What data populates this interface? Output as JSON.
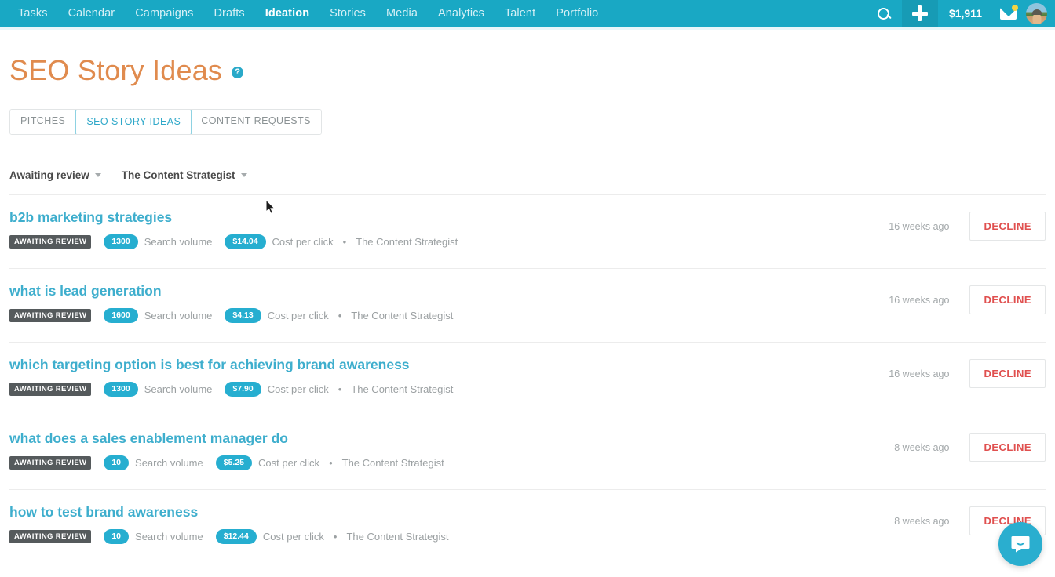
{
  "nav": {
    "links": [
      {
        "label": "Tasks",
        "active": false
      },
      {
        "label": "Calendar",
        "active": false
      },
      {
        "label": "Campaigns",
        "active": false
      },
      {
        "label": "Drafts",
        "active": false
      },
      {
        "label": "Ideation",
        "active": true
      },
      {
        "label": "Stories",
        "active": false
      },
      {
        "label": "Media",
        "active": false
      },
      {
        "label": "Analytics",
        "active": false
      },
      {
        "label": "Talent",
        "active": false
      },
      {
        "label": "Portfolio",
        "active": false
      }
    ],
    "balance": "$1,911",
    "accent_color": "#19a8c4"
  },
  "header": {
    "title": "SEO Story Ideas",
    "help_label": "?",
    "title_color": "#e08b4e"
  },
  "tabs": [
    {
      "label": "PITCHES",
      "active": false
    },
    {
      "label": "SEO STORY IDEAS",
      "active": true
    },
    {
      "label": "CONTENT REQUESTS",
      "active": false
    }
  ],
  "filters": [
    {
      "label": "Awaiting review"
    },
    {
      "label": "The Content Strategist"
    }
  ],
  "labels": {
    "search_volume": "Search volume",
    "cost_per_click": "Cost per click",
    "separator": "•",
    "decline": "DECLINE"
  },
  "rows": [
    {
      "title": "b2b marketing strategies",
      "status": "AWAITING REVIEW",
      "search_volume": "1300",
      "cost_per_click": "$14.04",
      "publication": "The Content Strategist",
      "time": "16 weeks ago",
      "action": "DECLINE"
    },
    {
      "title": "what is lead generation",
      "status": "AWAITING REVIEW",
      "search_volume": "1600",
      "cost_per_click": "$4.13",
      "publication": "The Content Strategist",
      "time": "16 weeks ago",
      "action": "DECLINE"
    },
    {
      "title": "which targeting option is best for achieving brand awareness",
      "status": "AWAITING REVIEW",
      "search_volume": "1300",
      "cost_per_click": "$7.90",
      "publication": "The Content Strategist",
      "time": "16 weeks ago",
      "action": "DECLINE"
    },
    {
      "title": "what does a sales enablement manager do",
      "status": "AWAITING REVIEW",
      "search_volume": "10",
      "cost_per_click": "$5.25",
      "publication": "The Content Strategist",
      "time": "8 weeks ago",
      "action": "DECLINE"
    },
    {
      "title": "how to test brand awareness",
      "status": "AWAITING REVIEW",
      "search_volume": "10",
      "cost_per_click": "$12.44",
      "publication": "The Content Strategist",
      "time": "8 weeks ago",
      "action": "DECLINE"
    }
  ]
}
